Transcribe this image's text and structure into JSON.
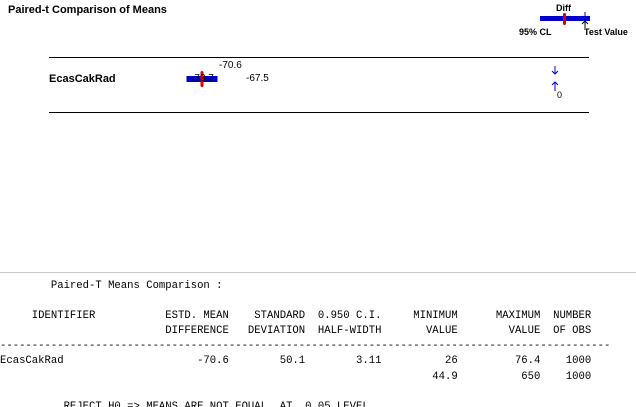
{
  "chart": {
    "title": "Paired-t Comparison of Means",
    "legend": {
      "diff_label": "Diff",
      "cl_label": "95% CL",
      "test_value_label": "Test Value"
    },
    "test_value_label": "0"
  },
  "chart_data": {
    "type": "interval",
    "title": "Paired-t Comparison of Means",
    "series": [
      {
        "name": "EcasCakRad",
        "diff": -70.6,
        "ci_low": -73.7,
        "ci_high": -67.5
      }
    ],
    "test_value": 0,
    "colors": {
      "interval": "#0000cc",
      "mean_marker": "#dd0000",
      "arrow": "#0000cc"
    }
  },
  "output": {
    "heading": "Paired-T Means Comparison :",
    "header_row1": [
      "IDENTIFIER",
      "ESTD. MEAN",
      "STANDARD",
      "0.950 C.I.",
      "MINIMUM",
      "MAXIMUM",
      "NUMBER"
    ],
    "header_row2": [
      "",
      "DIFFERENCE",
      "DEVIATION",
      "HALF-WIDTH",
      "VALUE",
      "VALUE",
      "OF OBS"
    ],
    "rows": [
      [
        "EcasCakRad",
        "-70.6",
        "50.1",
        "3.11",
        "26",
        "76.4",
        "1000"
      ],
      [
        "",
        "",
        "",
        "",
        "44.9",
        "650",
        "1000"
      ]
    ],
    "conclusion": "REJECT H0 => MEANS ARE NOT EQUAL  AT  0.05 LEVEL"
  }
}
